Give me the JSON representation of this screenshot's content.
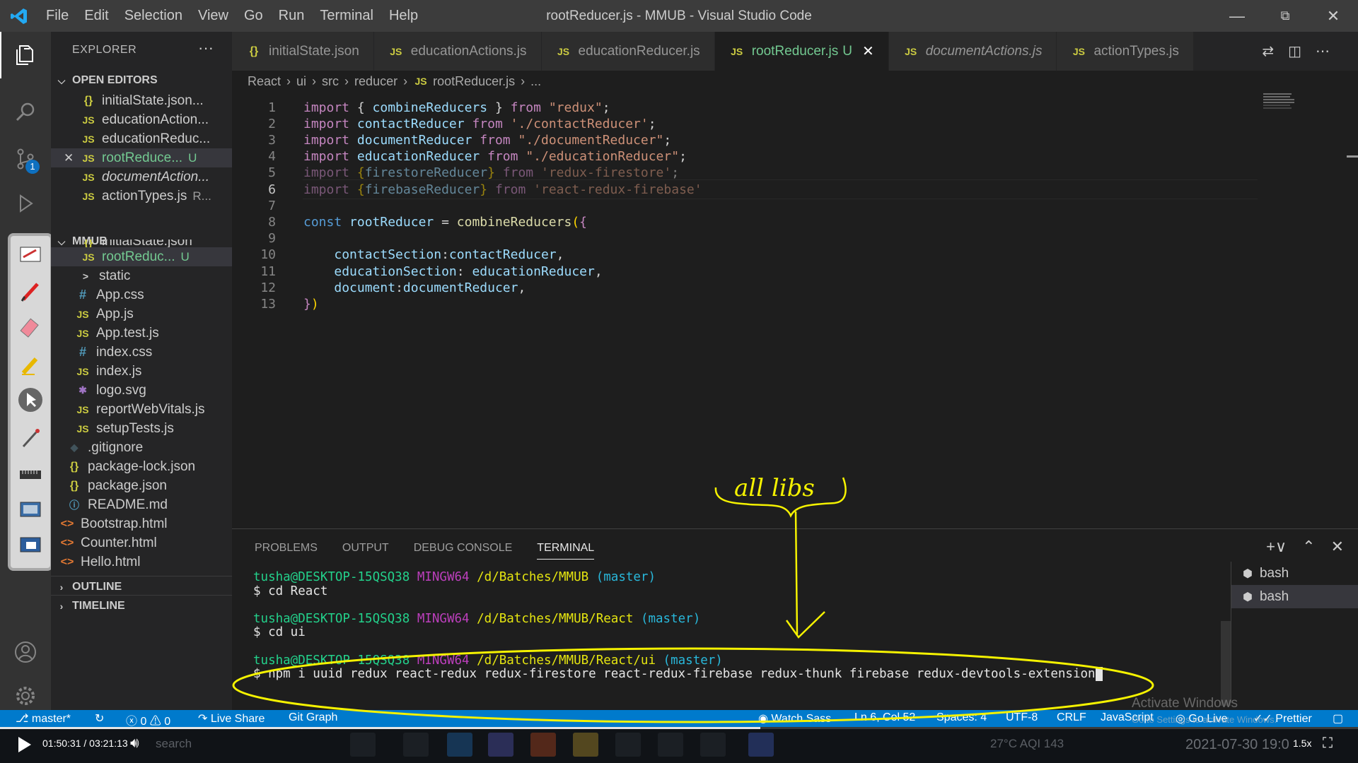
{
  "window": {
    "title": "rootReducer.js - MMUB - Visual Studio Code",
    "menu": [
      "File",
      "Edit",
      "Selection",
      "View",
      "Go",
      "Run",
      "Terminal",
      "Help"
    ]
  },
  "activity": {
    "source_control_badge": "1"
  },
  "explorer": {
    "header": "EXPLORER",
    "more": "···",
    "open_editors_title": "OPEN EDITORS",
    "open_editors": [
      {
        "icon": "{}",
        "label": "initialState.json...",
        "status": "",
        "italic": false
      },
      {
        "icon": "JS",
        "label": "educationAction...",
        "status": "",
        "italic": false
      },
      {
        "icon": "JS",
        "label": "educationReduc...",
        "status": "",
        "italic": false
      },
      {
        "icon": "JS",
        "label": "rootReduce...",
        "status": "U",
        "italic": false
      },
      {
        "icon": "JS",
        "label": "documentAction...",
        "status": "",
        "italic": true
      },
      {
        "icon": "JS",
        "label": "actionTypes.js",
        "status": "R...",
        "italic": false
      }
    ],
    "project_title": "MMUB",
    "tree": [
      {
        "icon": "{}",
        "label": "initialState.json",
        "status": ""
      },
      {
        "icon": "JS",
        "label": "rootReduc...",
        "status": "U"
      },
      {
        "icon": ">",
        "label": "static",
        "status": ""
      },
      {
        "icon": "#",
        "label": "App.css",
        "status": ""
      },
      {
        "icon": "JS",
        "label": "App.js",
        "status": ""
      },
      {
        "icon": "JS",
        "label": "App.test.js",
        "status": ""
      },
      {
        "icon": "#",
        "label": "index.css",
        "status": ""
      },
      {
        "icon": "JS",
        "label": "index.js",
        "status": ""
      },
      {
        "icon": "✱",
        "label": "logo.svg",
        "status": ""
      },
      {
        "icon": "JS",
        "label": "reportWebVitals.js",
        "status": ""
      },
      {
        "icon": "JS",
        "label": "setupTests.js",
        "status": ""
      },
      {
        "icon": "◆",
        "label": ".gitignore",
        "status": ""
      },
      {
        "icon": "{}",
        "label": "package-lock.json",
        "status": ""
      },
      {
        "icon": "{}",
        "label": "package.json",
        "status": ""
      },
      {
        "icon": "ⓘ",
        "label": "README.md",
        "status": ""
      },
      {
        "icon": "<>",
        "label": "Bootstrap.html",
        "status": ""
      },
      {
        "icon": "<>",
        "label": "Counter.html",
        "status": ""
      },
      {
        "icon": "<>",
        "label": "Hello.html",
        "status": ""
      }
    ],
    "outline": "OUTLINE",
    "timeline": "TIMELINE"
  },
  "tabs": [
    {
      "icon": "{}",
      "label": "initialState.json",
      "active": false,
      "italic": false
    },
    {
      "icon": "JS",
      "label": "educationActions.js",
      "active": false,
      "italic": false
    },
    {
      "icon": "JS",
      "label": "educationReducer.js",
      "active": false,
      "italic": false
    },
    {
      "icon": "JS",
      "label": "rootReducer.js",
      "active": true,
      "italic": false,
      "status": "U"
    },
    {
      "icon": "JS",
      "label": "documentActions.js",
      "active": false,
      "italic": true
    },
    {
      "icon": "JS",
      "label": "actionTypes.js",
      "active": false,
      "italic": false
    }
  ],
  "breadcrumb": [
    "React",
    "ui",
    "src",
    "reducer",
    "rootReducer.js",
    "..."
  ],
  "editor": {
    "current_line": 6,
    "lines": [
      [
        [
          "kw",
          "import"
        ],
        [
          "pn",
          " { "
        ],
        [
          "id",
          "combineReducers"
        ],
        [
          "pn",
          " } "
        ],
        [
          "kw",
          "from"
        ],
        [
          "pn",
          " "
        ],
        [
          "str",
          "\"redux\""
        ],
        [
          "pn",
          ";"
        ]
      ],
      [
        [
          "kw",
          "import"
        ],
        [
          "pn",
          " "
        ],
        [
          "id",
          "contactReducer"
        ],
        [
          "pn",
          " "
        ],
        [
          "kw",
          "from"
        ],
        [
          "pn",
          " "
        ],
        [
          "str",
          "'./contactReducer'"
        ],
        [
          "pn",
          ";"
        ]
      ],
      [
        [
          "kw",
          "import"
        ],
        [
          "pn",
          " "
        ],
        [
          "id",
          "documentReducer"
        ],
        [
          "pn",
          " "
        ],
        [
          "kw",
          "from"
        ],
        [
          "pn",
          " "
        ],
        [
          "str",
          "\"./documentReducer\""
        ],
        [
          "pn",
          ";"
        ]
      ],
      [
        [
          "kw",
          "import"
        ],
        [
          "pn",
          " "
        ],
        [
          "id",
          "educationReducer"
        ],
        [
          "pn",
          " "
        ],
        [
          "kw",
          "from"
        ],
        [
          "pn",
          " "
        ],
        [
          "str",
          "\"./educationReducer\""
        ],
        [
          "pn",
          ";"
        ]
      ],
      [
        [
          "kw dim",
          "import"
        ],
        [
          "pn dim",
          " "
        ],
        [
          "br dim",
          "{"
        ],
        [
          "id dim",
          "firestoreReducer"
        ],
        [
          "br dim",
          "}"
        ],
        [
          "pn dim",
          " "
        ],
        [
          "kw dim",
          "from"
        ],
        [
          "pn dim",
          " "
        ],
        [
          "str dim",
          "'redux-firestore'"
        ],
        [
          "pn dim",
          ";"
        ]
      ],
      [
        [
          "kw dim",
          "import"
        ],
        [
          "pn dim",
          " "
        ],
        [
          "br dim",
          "{"
        ],
        [
          "id dim",
          "firebaseReducer"
        ],
        [
          "br dim",
          "}"
        ],
        [
          "pn dim",
          " "
        ],
        [
          "kw dim",
          "from"
        ],
        [
          "pn dim",
          " "
        ],
        [
          "str dim",
          "'react-redux-firebase'"
        ]
      ],
      [],
      [
        [
          "st",
          "const"
        ],
        [
          "pn",
          " "
        ],
        [
          "id",
          "rootReducer"
        ],
        [
          "pn",
          " = "
        ],
        [
          "fn",
          "combineReducers"
        ],
        [
          "br",
          "("
        ],
        [
          "kw",
          "{"
        ]
      ],
      [],
      [
        [
          "pn",
          "    "
        ],
        [
          "id",
          "contactSection"
        ],
        [
          "pn",
          ":"
        ],
        [
          "id",
          "contactReducer"
        ],
        [
          "pn",
          ","
        ]
      ],
      [
        [
          "pn",
          "    "
        ],
        [
          "id",
          "educationSection"
        ],
        [
          "pn",
          ": "
        ],
        [
          "id",
          "educationReducer"
        ],
        [
          "pn",
          ","
        ]
      ],
      [
        [
          "pn",
          "    "
        ],
        [
          "id",
          "document"
        ],
        [
          "pn",
          ":"
        ],
        [
          "id",
          "documentReducer"
        ],
        [
          "pn",
          ","
        ]
      ],
      [
        [
          "kw",
          "}"
        ],
        [
          "br",
          ")"
        ]
      ]
    ]
  },
  "panel": {
    "tabs": [
      "PROBLEMS",
      "OUTPUT",
      "DEBUG CONSOLE",
      "TERMINAL"
    ],
    "active_tab": "TERMINAL",
    "terminals": [
      "bash",
      "bash"
    ],
    "lines": [
      {
        "type": "prompt",
        "user": "tusha@DESKTOP-15QSQ38",
        "host": "MINGW64",
        "path": "/d/Batches/MMUB",
        "branch": "(master)"
      },
      {
        "type": "cmd",
        "text": "$ cd React"
      },
      {
        "type": "blank"
      },
      {
        "type": "prompt",
        "user": "tusha@DESKTOP-15QSQ38",
        "host": "MINGW64",
        "path": "/d/Batches/MMUB/React",
        "branch": "(master)"
      },
      {
        "type": "cmd",
        "text": "$ cd ui"
      },
      {
        "type": "blank"
      },
      {
        "type": "prompt",
        "user": "tusha@DESKTOP-15QSQ38",
        "host": "MINGW64",
        "path": "/d/Batches/MMUB/React/ui",
        "branch": "(master)"
      },
      {
        "type": "cmd",
        "text": "$ npm i uuid redux react-redux redux-firestore react-redux-firebase redux-thunk firebase redux-devtools-extension",
        "cursor": true
      }
    ]
  },
  "annotation": {
    "text": "all libs",
    "color": "#f5f200"
  },
  "statusbar": {
    "branch": "master*",
    "problems": "ⓧ 0 ⚠ 0",
    "liveshare": "Live Share",
    "gitgraph": "Git Graph",
    "watch": "Watch Sass",
    "position": "Ln 6, Col 52",
    "spaces": "Spaces: 4",
    "encoding": "UTF-8",
    "eol": "CRLF",
    "language": "JavaScript",
    "golive": "Go Live",
    "prettier": "Prettier"
  },
  "watermark": {
    "title": "Activate Windows",
    "subtitle": "Go to Settings to activate Windows."
  },
  "player": {
    "time": "01:50:31 / 03:21:13",
    "speed": "1.5x",
    "search": "search",
    "weather": "27°C  AQI 143",
    "datetime": "2021-07-30  19:0"
  },
  "colors": {
    "accent": "#007acc",
    "annotation": "#f5f200",
    "modified": "#73c991"
  }
}
